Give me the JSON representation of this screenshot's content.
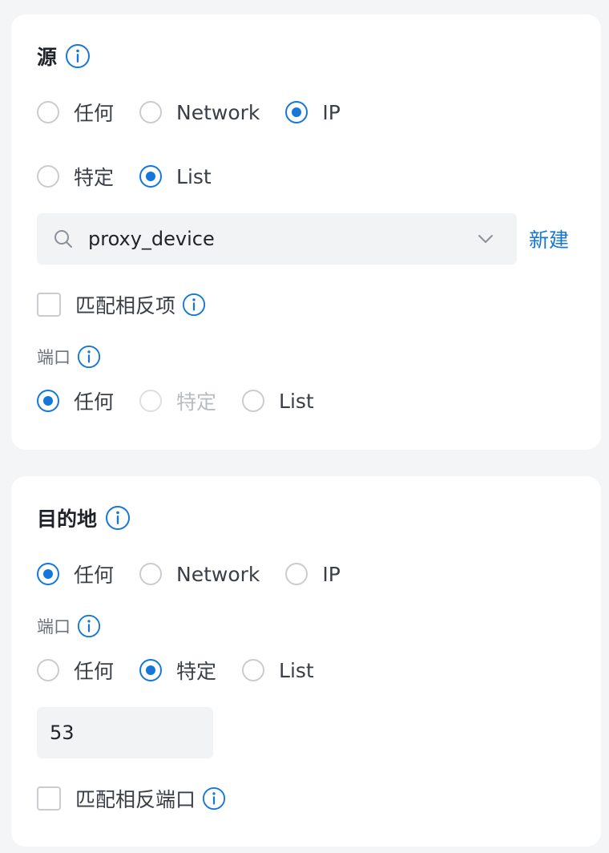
{
  "colors": {
    "accent": "#1677d8",
    "card": "#ffffff",
    "background": "#f4f5f7"
  },
  "source": {
    "title": "源",
    "type_options": [
      {
        "label": "任何",
        "checked": false
      },
      {
        "label": "Network",
        "checked": false
      },
      {
        "label": "IP",
        "checked": true
      }
    ],
    "ip_mode_options": [
      {
        "label": "特定",
        "checked": false
      },
      {
        "label": "List",
        "checked": true
      }
    ],
    "list_select": {
      "value": "proxy_device",
      "icon": "search-icon",
      "dropdown_icon": "chevron-down-icon"
    },
    "new_label": "新建",
    "invert_label": "匹配相反项",
    "invert_checked": false,
    "port_label": "端口",
    "port_options": [
      {
        "label": "任何",
        "checked": true,
        "disabled": false
      },
      {
        "label": "特定",
        "checked": false,
        "disabled": true
      },
      {
        "label": "List",
        "checked": false,
        "disabled": false
      }
    ]
  },
  "destination": {
    "title": "目的地",
    "type_options": [
      {
        "label": "任何",
        "checked": true
      },
      {
        "label": "Network",
        "checked": false
      },
      {
        "label": "IP",
        "checked": false
      }
    ],
    "port_label": "端口",
    "port_options": [
      {
        "label": "任何",
        "checked": false
      },
      {
        "label": "特定",
        "checked": true
      },
      {
        "label": "List",
        "checked": false
      }
    ],
    "port_value": "53",
    "invert_label": "匹配相反端口",
    "invert_checked": false
  }
}
